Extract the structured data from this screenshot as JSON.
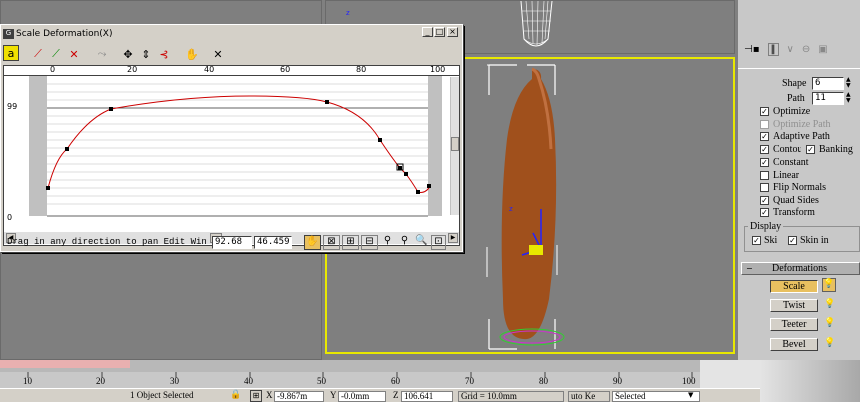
{
  "dialog": {
    "title": "Scale Deformation(X)",
    "toolbar_icons": [
      "lock-icon",
      "curve-icon-red",
      "curve-icon-green",
      "curve-icon-both",
      "swap-icon",
      "move-icon",
      "scale-vertical-icon",
      "insert-point-icon",
      "reset-icon",
      "delete-icon"
    ],
    "ruler_ticks": [
      "0",
      "20",
      "40",
      "60",
      "80",
      "100"
    ],
    "y_label_top": "99",
    "y_label_bottom": "0",
    "status_text": "Drag in any direction to pan Edit Win",
    "field_x": "92.68",
    "field_y": "46.459"
  },
  "panel": {
    "shape_label": "Shape",
    "shape_value": "6",
    "path_label": "Path",
    "path_value": "11",
    "options": [
      {
        "label": "Optimize",
        "checked": true,
        "disabled": false
      },
      {
        "label": "Optimize Path",
        "checked": false,
        "disabled": true
      },
      {
        "label": "Adaptive Path",
        "checked": true,
        "disabled": false
      },
      {
        "label": "Contour",
        "checked": true,
        "disabled": false
      },
      {
        "label": "Banking",
        "checked": true,
        "disabled": false
      },
      {
        "label": "Constant",
        "checked": true,
        "disabled": false
      },
      {
        "label": "Linear",
        "checked": false,
        "disabled": false
      },
      {
        "label": "Flip Normals",
        "checked": false,
        "disabled": false
      },
      {
        "label": "Quad Sides",
        "checked": true,
        "disabled": false
      },
      {
        "label": "Transform",
        "checked": true,
        "disabled": false
      }
    ],
    "display_label": "Display",
    "display_skin": "Ski",
    "display_skin_in": "Skin in",
    "deformations_label": "Deformations",
    "buttons": [
      "Scale",
      "Twist",
      "Teeter",
      "Bevel"
    ]
  },
  "timeline": {
    "ticks": [
      "10",
      "20",
      "30",
      "40",
      "50",
      "60",
      "70",
      "80",
      "90",
      "100"
    ]
  },
  "statusbar": {
    "selection": "1 Object Selected",
    "x_label": "X",
    "x_value": "-9.867m",
    "y_label": "Y",
    "y_value": "-0.0mm",
    "z_label": "Z",
    "z_value": "106.641",
    "grid": "Grid = 10.0mm",
    "autokey": "uto Ke",
    "selected": "Selected"
  },
  "colors": {
    "curve": "#cc0000",
    "viewport_active": "#e8e800",
    "bottle": "#a0501c"
  }
}
